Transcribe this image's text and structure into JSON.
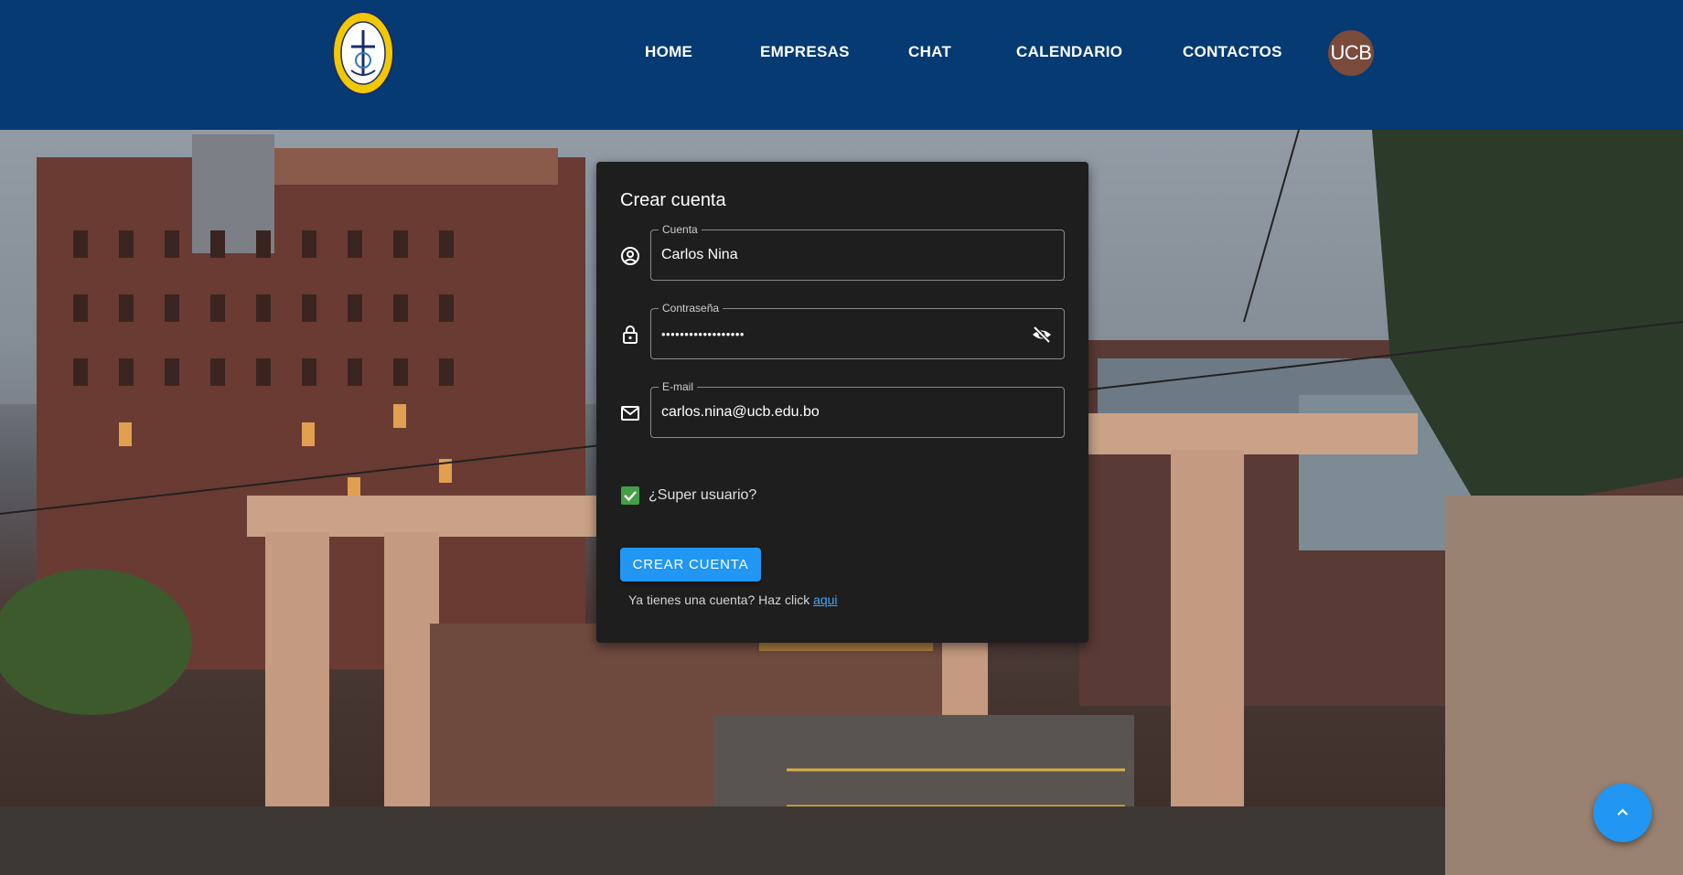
{
  "header": {
    "logo_icon": "university-seal-icon",
    "nav": [
      {
        "label": "HOME"
      },
      {
        "label": "EMPRESAS"
      },
      {
        "label": "CHAT"
      },
      {
        "label": "CALENDARIO"
      },
      {
        "label": "CONTACTOS"
      }
    ],
    "avatar_text": "UCB"
  },
  "form": {
    "title": "Crear cuenta",
    "account": {
      "label": "Cuenta",
      "value": "Carlos Nina",
      "icon": "account-circle-icon"
    },
    "password": {
      "label": "Contraseña",
      "value": "••••••••••••••••••",
      "icon": "lock-icon",
      "toggle_icon": "eye-off-icon"
    },
    "email": {
      "label": "E-mail",
      "value": "carlos.nina@ucb.edu.bo",
      "icon": "mail-icon"
    },
    "superuser": {
      "label": "¿Super usuario?",
      "checked": true
    },
    "submit_label": "CREAR CUENTA",
    "login_prompt": "Ya tienes una cuenta? Haz click ",
    "login_link": "aqui"
  },
  "fab": {
    "icon": "chevron-up-icon"
  },
  "colors": {
    "header_bg": "#053a73",
    "card_bg": "#1e1e1e",
    "primary": "#2196f3",
    "checkbox": "#43a047",
    "avatar_bg": "#7a4a3a"
  }
}
